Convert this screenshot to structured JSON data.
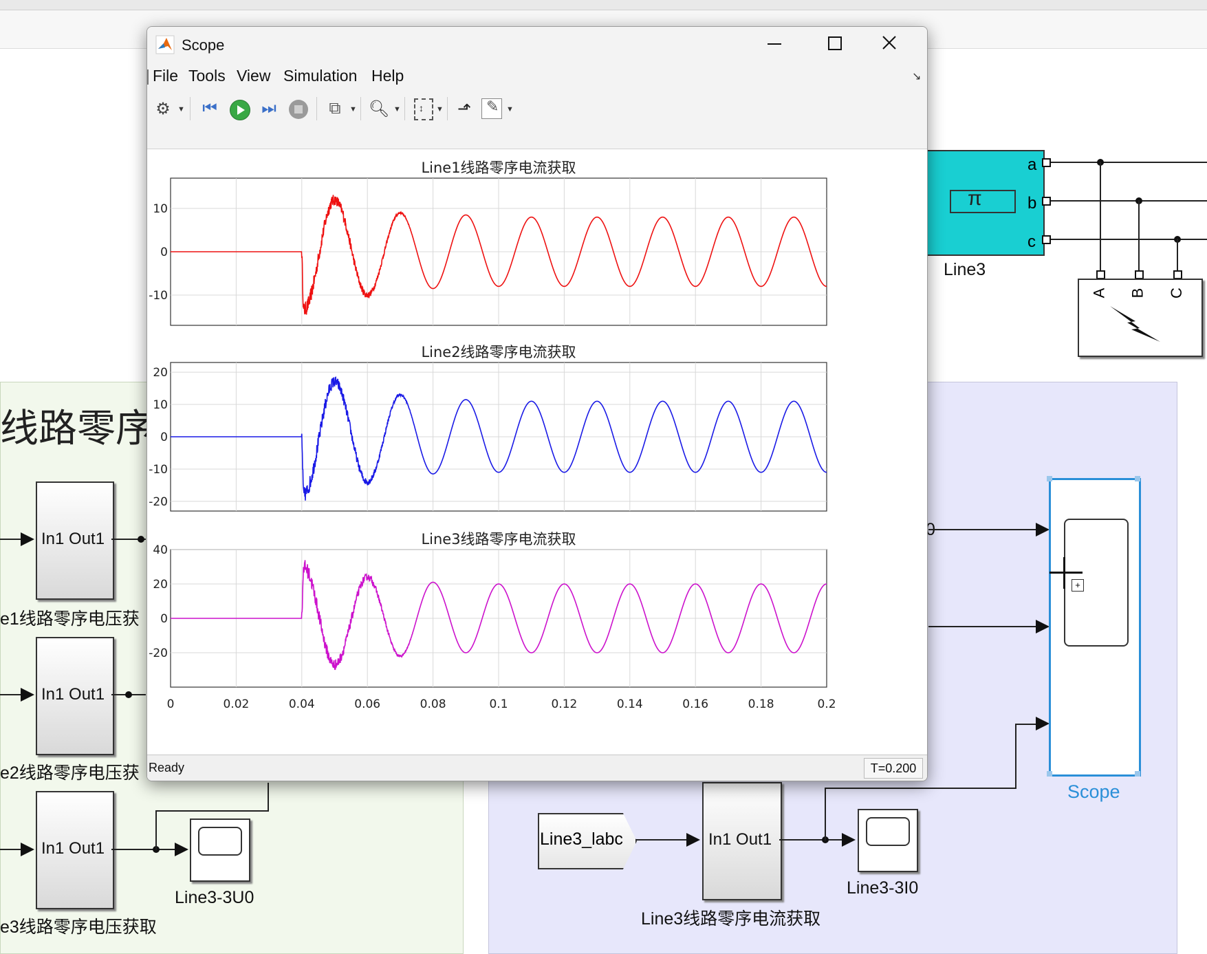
{
  "scope_window": {
    "title": "Scope",
    "menu": [
      "File",
      "Tools",
      "View",
      "Simulation",
      "Help"
    ],
    "toolbar_icons": [
      "gear-icon",
      "rewind-icon",
      "run-icon",
      "step-forward-icon",
      "stop-icon",
      "signal-selector-icon",
      "zoom-icon",
      "scale-axes-icon",
      "highlight-icon",
      "edit-icon"
    ],
    "status_left": "Ready",
    "status_right": "T=0.200",
    "colors": {
      "line1": "#ee1111",
      "line2": "#1a1ae6",
      "line3": "#cc11cc"
    }
  },
  "chart_data": [
    {
      "type": "line",
      "title": "Line1线路零序电流获取",
      "xlim": [
        0,
        0.2
      ],
      "ylim": [
        -17,
        17
      ],
      "y_ticks": [
        "10",
        "0",
        "-10"
      ],
      "y_tick_values": [
        10,
        0,
        -10
      ],
      "x_ticks": [
        "0",
        "0.02",
        "0.04",
        "0.06",
        "0.08",
        "0.1",
        "0.12",
        "0.14",
        "0.16",
        "0.18",
        "0.2"
      ],
      "show_x_tick_labels": false,
      "grid": true,
      "color": "#ee1111",
      "series": [
        {
          "fault_time": 0.04,
          "frequency_hz": 50,
          "steady_amplitude": 8,
          "peaks": [
            [
              0.0405,
              -13.5
            ],
            [
              0.05,
              12
            ],
            [
              0.06,
              -10
            ],
            [
              0.07,
              9
            ],
            [
              0.08,
              -8.5
            ],
            [
              0.09,
              8.5
            ],
            [
              0.1,
              -8
            ],
            [
              0.11,
              8
            ],
            [
              0.12,
              -8
            ],
            [
              0.13,
              8
            ],
            [
              0.14,
              -8
            ],
            [
              0.15,
              8
            ],
            [
              0.16,
              -8
            ],
            [
              0.17,
              8
            ],
            [
              0.18,
              -8
            ],
            [
              0.19,
              8
            ],
            [
              0.2,
              -8
            ]
          ],
          "noise_decay": [
            0.04,
            0.075
          ]
        }
      ]
    },
    {
      "type": "line",
      "title": "Line2线路零序电流获取",
      "xlim": [
        0,
        0.2
      ],
      "ylim": [
        -23,
        23
      ],
      "y_ticks": [
        "20",
        "10",
        "0",
        "-10",
        "-20"
      ],
      "y_tick_values": [
        20,
        10,
        0,
        -10,
        -20
      ],
      "x_ticks": [
        "0",
        "0.02",
        "0.04",
        "0.06",
        "0.08",
        "0.1",
        "0.12",
        "0.14",
        "0.16",
        "0.18",
        "0.2"
      ],
      "show_x_tick_labels": false,
      "grid": true,
      "color": "#1a1ae6",
      "series": [
        {
          "fault_time": 0.04,
          "frequency_hz": 50,
          "steady_amplitude": 11,
          "peaks": [
            [
              0.0405,
              -18
            ],
            [
              0.05,
              17
            ],
            [
              0.06,
              -14
            ],
            [
              0.07,
              13
            ],
            [
              0.08,
              -11.5
            ],
            [
              0.09,
              11.5
            ],
            [
              0.1,
              -11
            ],
            [
              0.11,
              11
            ],
            [
              0.12,
              -11
            ],
            [
              0.13,
              11
            ],
            [
              0.14,
              -11
            ],
            [
              0.15,
              11
            ],
            [
              0.16,
              -11
            ],
            [
              0.17,
              11
            ],
            [
              0.18,
              -11
            ],
            [
              0.19,
              11
            ],
            [
              0.2,
              -11
            ]
          ],
          "noise_decay": [
            0.04,
            0.075
          ]
        }
      ]
    },
    {
      "type": "line",
      "title": "Line3线路零序电流获取",
      "xlim": [
        0,
        0.2
      ],
      "ylim": [
        -40,
        40
      ],
      "y_ticks": [
        "40",
        "20",
        "0",
        "-20"
      ],
      "y_tick_values": [
        40,
        20,
        0,
        -20
      ],
      "x_ticks": [
        "0",
        "0.02",
        "0.04",
        "0.06",
        "0.08",
        "0.1",
        "0.12",
        "0.14",
        "0.16",
        "0.18",
        "0.2"
      ],
      "show_x_tick_labels": true,
      "grid": true,
      "color": "#cc11cc",
      "series": [
        {
          "fault_time": 0.04,
          "frequency_hz": 50,
          "steady_amplitude": 20,
          "peaks": [
            [
              0.0405,
              30
            ],
            [
              0.05,
              -27
            ],
            [
              0.06,
              24
            ],
            [
              0.07,
              -22
            ],
            [
              0.08,
              21
            ],
            [
              0.09,
              -20
            ],
            [
              0.1,
              20
            ],
            [
              0.11,
              -20
            ],
            [
              0.12,
              20
            ],
            [
              0.13,
              -20
            ],
            [
              0.14,
              20
            ],
            [
              0.15,
              -20
            ],
            [
              0.16,
              20
            ],
            [
              0.17,
              -20
            ],
            [
              0.18,
              20
            ],
            [
              0.19,
              -20
            ],
            [
              0.2,
              20
            ]
          ],
          "noise_decay": [
            0.04,
            0.075
          ]
        }
      ]
    }
  ],
  "model": {
    "area_left_title": "线路零序",
    "blocks": {
      "in_out_label": "In1 Out1",
      "line3_label": "Line3",
      "line3_ports": [
        "a",
        "b",
        "c"
      ],
      "fault_ports": [
        "A",
        "B",
        "C"
      ],
      "pi_symbol": "π",
      "goto_label": "Line3_labc",
      "scope_label": "Scope",
      "line3_3u0": "Line3-3U0",
      "line3_3i0": "Line3-3I0",
      "partial_0": "0"
    },
    "captions": {
      "cap1": "e1线路零序电压获",
      "cap2": "e2线路零序电压获",
      "cap3": "e3线路零序电压获取",
      "cap_right": "Line3线路零序电流获取"
    }
  }
}
